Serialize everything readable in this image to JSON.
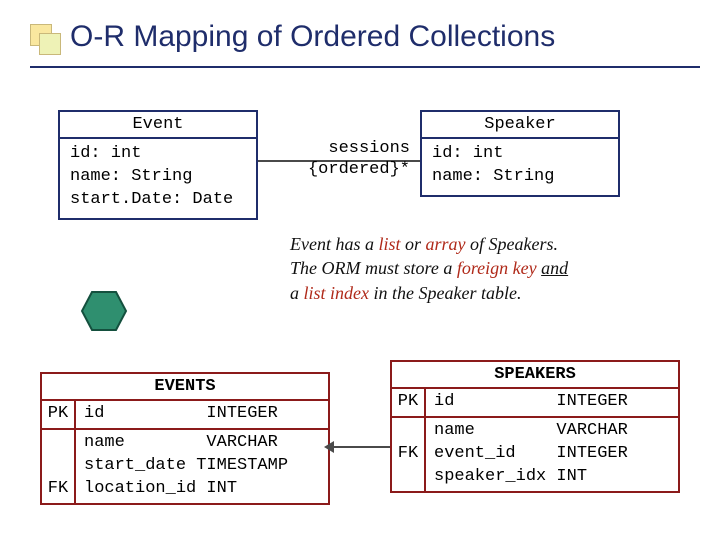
{
  "title": "O-R Mapping of Ordered Collections",
  "event_class": {
    "name": "Event",
    "attrs": "id: int\nname: String\nstart.Date: Date"
  },
  "speaker_class": {
    "name": "Speaker",
    "attrs": "id: int\nname: String"
  },
  "assoc": {
    "label": "sessions\n{ordered}*"
  },
  "explain": {
    "l1a": "Event has a ",
    "l1b": "list",
    "l1c": " or ",
    "l1d": "array",
    "l1e": " of Speakers.",
    "l2a": "The ORM must store a ",
    "l2b": "foreign key",
    "l2c": " ",
    "l2d": "and",
    "l3a": "a ",
    "l3b": "list index",
    "l3c": " in the Speaker table."
  },
  "events_table": {
    "name": "EVENTS",
    "key1": "PK",
    "cols1": "id          INTEGER",
    "key2": "\n\nFK",
    "cols2": "name        VARCHAR\nstart_date TIMESTAMP\nlocation_id INT"
  },
  "speakers_table": {
    "name": "SPEAKERS",
    "key1": "PK",
    "cols1": "id          INTEGER",
    "key2": "\nFK\n",
    "cols2": "name        VARCHAR\nevent_id    INTEGER\nspeaker_idx INT"
  }
}
